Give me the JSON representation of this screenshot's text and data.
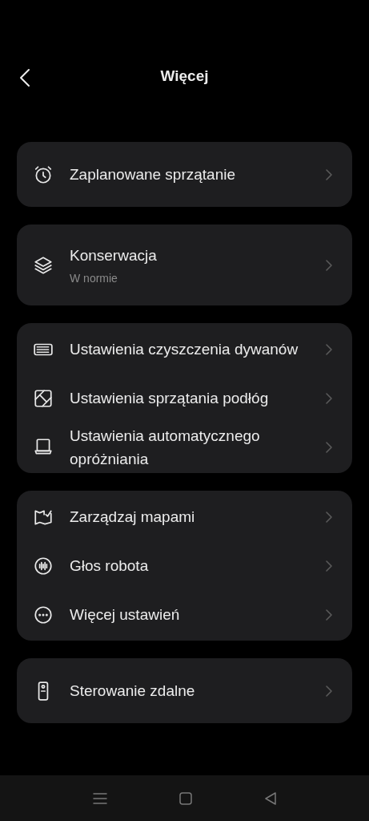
{
  "header": {
    "title": "Więcej"
  },
  "sections": [
    {
      "items": [
        {
          "label": "Zaplanowane sprzątanie"
        }
      ]
    },
    {
      "items": [
        {
          "label": "Konserwacja",
          "subtitle": "W normie"
        }
      ]
    },
    {
      "items": [
        {
          "label": "Ustawienia czyszczenia dywanów"
        },
        {
          "label": "Ustawienia sprzątania podłóg"
        },
        {
          "label": "Ustawienia automatycznego opróżniania"
        }
      ]
    },
    {
      "items": [
        {
          "label": "Zarządzaj mapami"
        },
        {
          "label": "Głos robota"
        },
        {
          "label": "Więcej ustawień"
        }
      ]
    },
    {
      "items": [
        {
          "label": "Sterowanie zdalne"
        }
      ]
    }
  ]
}
